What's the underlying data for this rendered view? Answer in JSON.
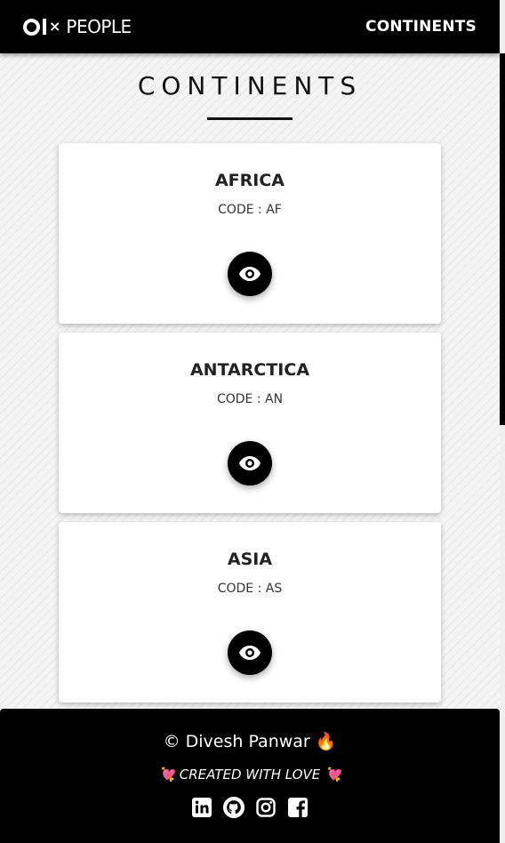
{
  "navbar": {
    "brand_logo_text": "OLX",
    "brand_name": "PEOPLE",
    "link_label": "CONTINENTS"
  },
  "page": {
    "title": "CONTINENTS"
  },
  "continents": [
    {
      "name": "AFRICA",
      "code_text": "CODE : AF",
      "action_icon": "eye-icon"
    },
    {
      "name": "ANTARCTICA",
      "code_text": "CODE : AN",
      "action_icon": "eye-icon"
    },
    {
      "name": "ASIA",
      "code_text": "CODE : AS",
      "action_icon": "eye-icon"
    }
  ],
  "footer": {
    "copyright": "© Divesh Panwar 🔥",
    "tagline": "💘 CREATED WITH LOVE 💘",
    "socials": [
      "linkedin-icon",
      "github-icon",
      "instagram-icon",
      "facebook-icon"
    ]
  },
  "colors": {
    "primary": "#000000",
    "card_bg": "#ffffff",
    "page_bg": "#f4f4f4"
  }
}
